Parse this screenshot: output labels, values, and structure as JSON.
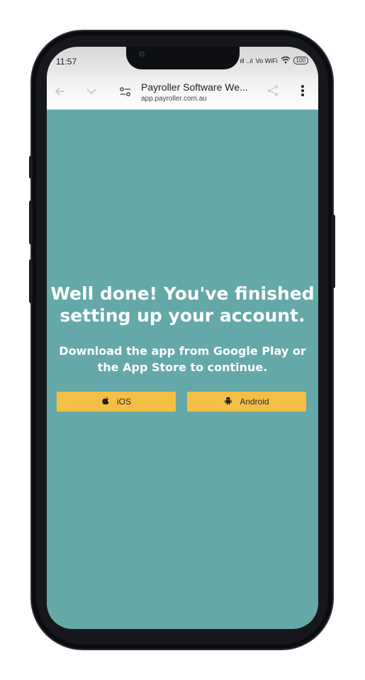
{
  "status_bar": {
    "time": "11:57",
    "signal_text": "ıll ..ıl",
    "network_text": "Vo WiFi",
    "wifi_icon": "wifi-icon",
    "battery": "100"
  },
  "browser": {
    "page_title": "Payroller Software We...",
    "url": "app.payroller.com.au",
    "back_icon": "arrow-left-icon",
    "dropdown_icon": "chevron-down-icon",
    "site_settings_icon": "tune-icon",
    "share_icon": "share-icon",
    "menu_icon": "more-vert-icon"
  },
  "main": {
    "headline": "Well done! You've finished setting up your account.",
    "subtext": "Download the app from Google Play or the App Store to continue.",
    "ios_button": "iOS",
    "android_button": "Android",
    "background_color": "#65a8a8",
    "button_color": "#f5bf45"
  },
  "chat": {
    "icon": "chat-icon"
  }
}
